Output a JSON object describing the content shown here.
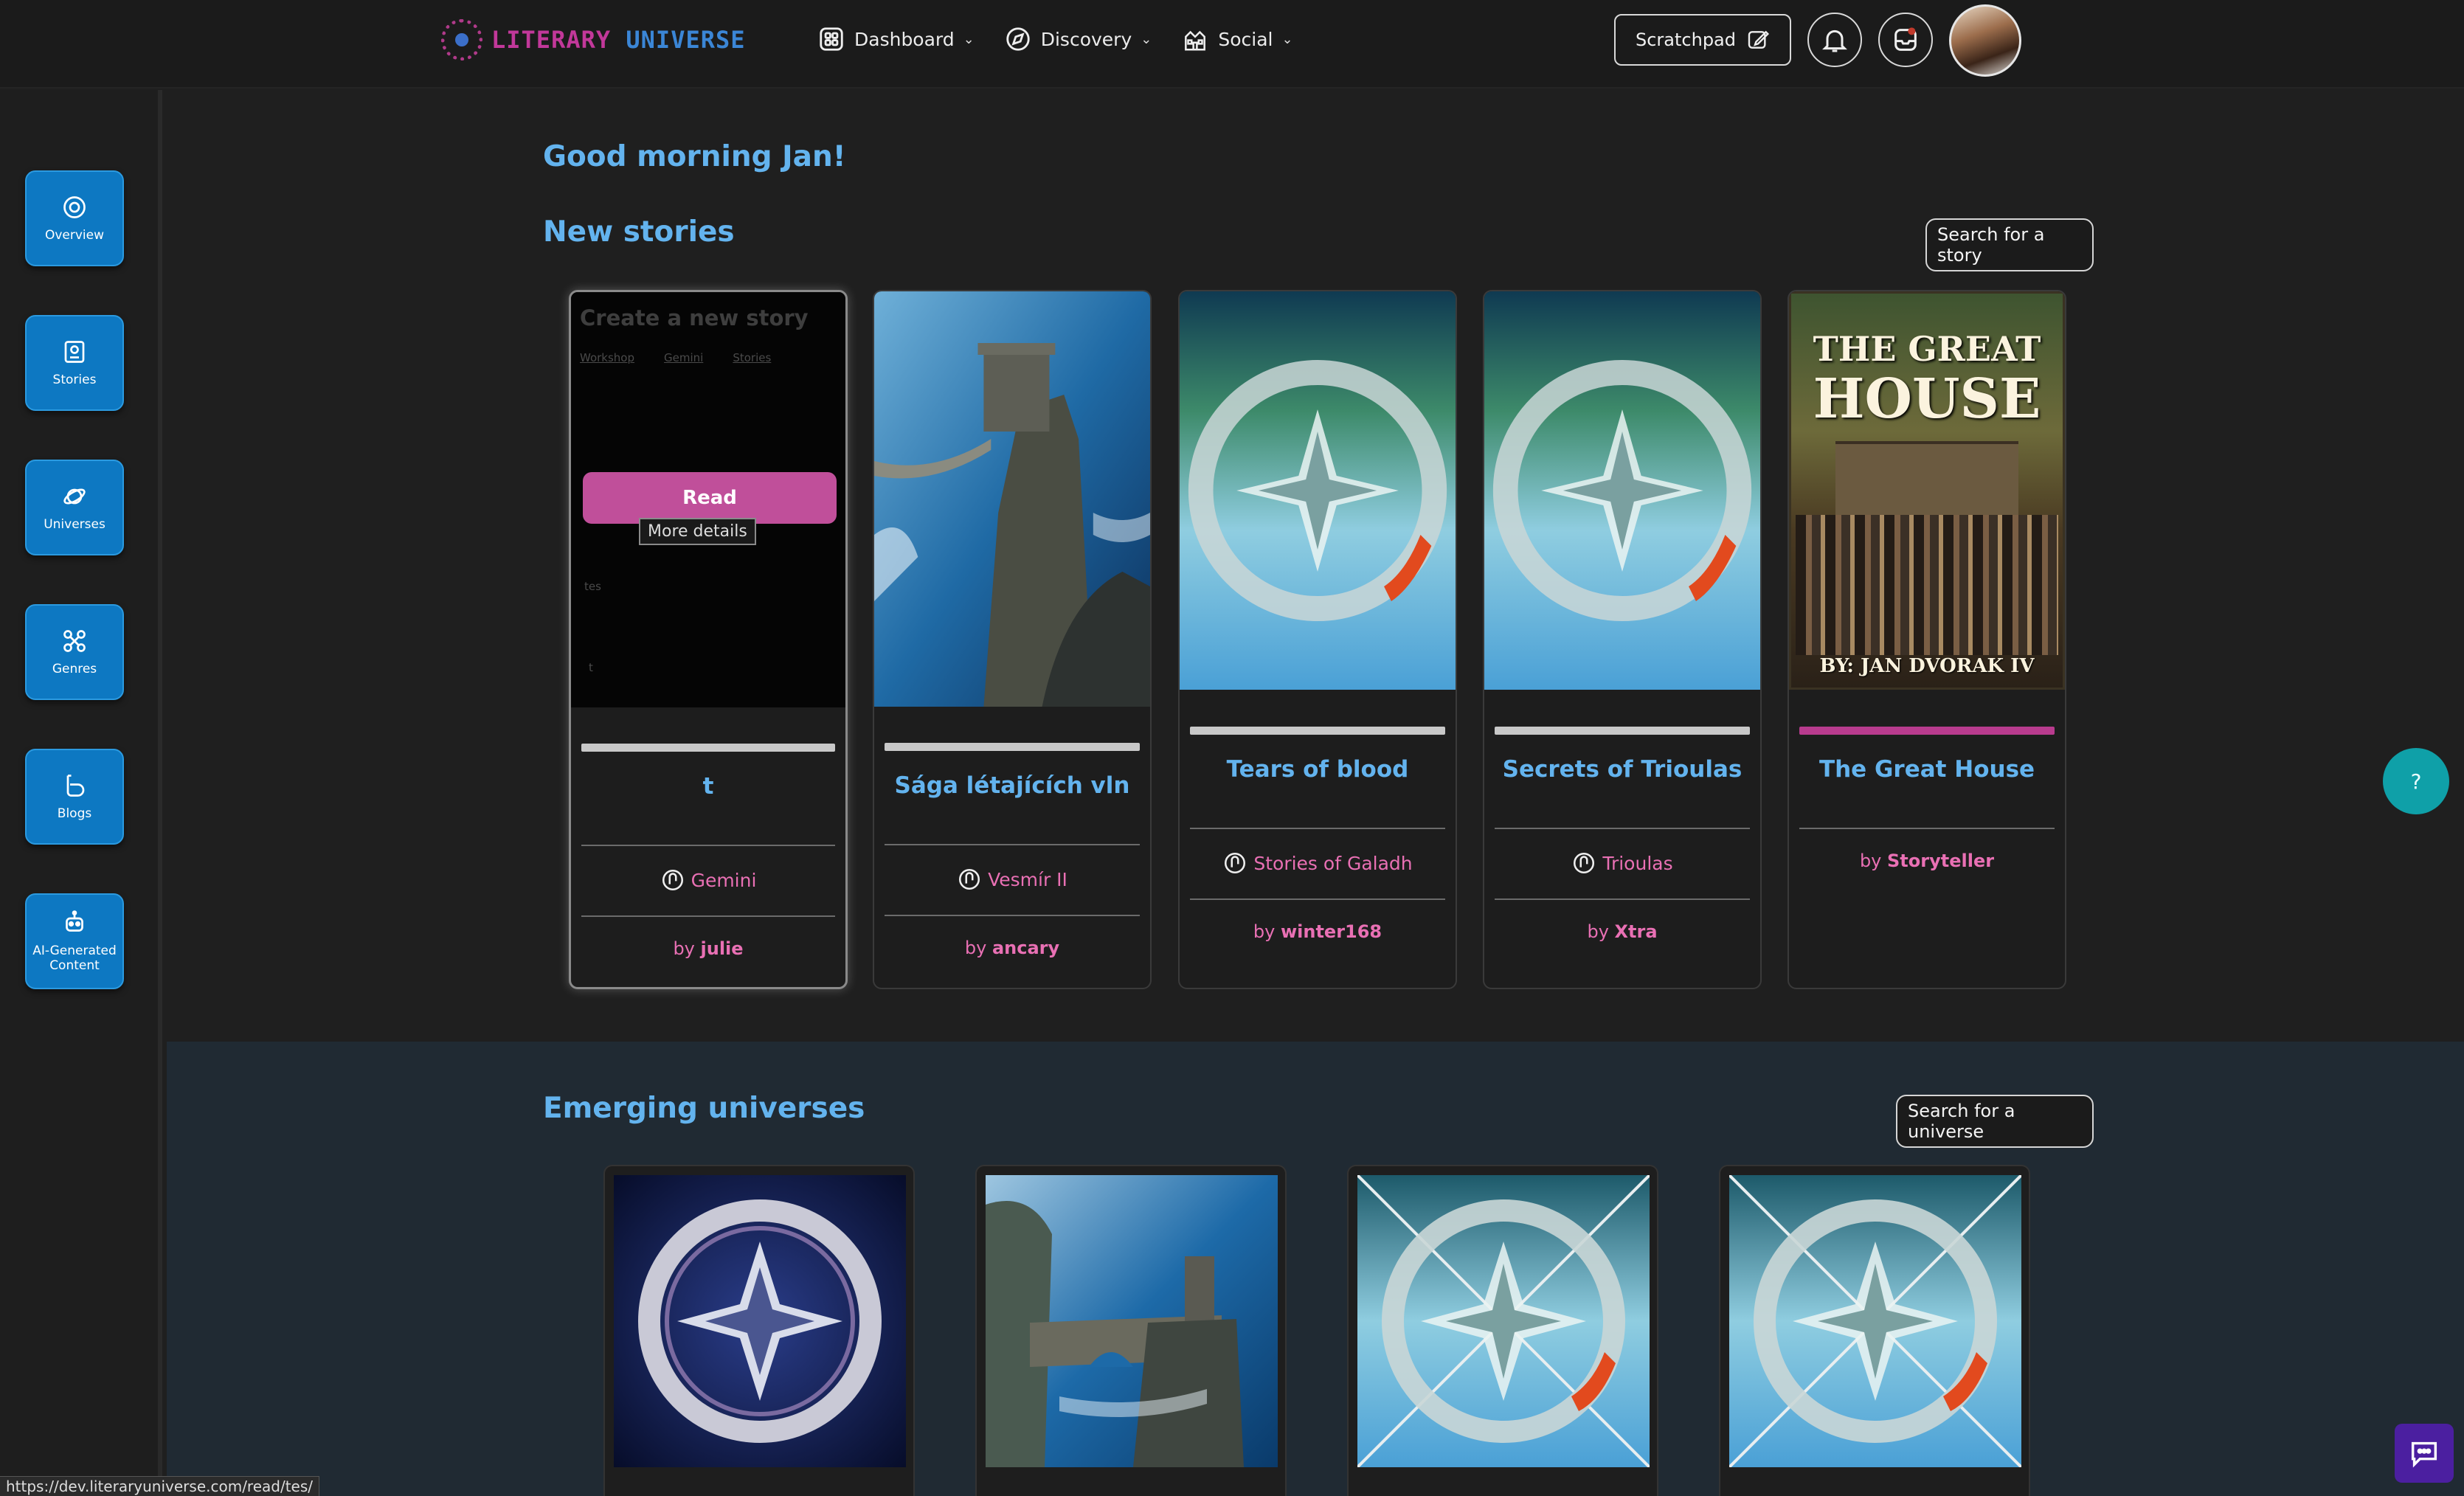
{
  "header": {
    "logo_literary": "LITERARY",
    "logo_universe": "UNIVERSE",
    "nav": [
      {
        "label": "Dashboard",
        "icon": "dashboard-icon"
      },
      {
        "label": "Discovery",
        "icon": "discovery-icon"
      },
      {
        "label": "Social",
        "icon": "social-icon"
      }
    ],
    "scratchpad_label": "Scratchpad"
  },
  "sidebar": {
    "items": [
      {
        "label": "Overview",
        "icon": "overview-icon"
      },
      {
        "label": "Stories",
        "icon": "stories-icon"
      },
      {
        "label": "Universes",
        "icon": "universes-icon"
      },
      {
        "label": "Genres",
        "icon": "genres-icon"
      },
      {
        "label": "Blogs",
        "icon": "blogs-icon"
      },
      {
        "label": "AI-Generated Content",
        "icon": "robot-icon"
      }
    ]
  },
  "main": {
    "greeting": "Good morning Jan!",
    "new_stories": {
      "title": "New stories",
      "search_label": "Search for a story",
      "cards": [
        {
          "title": "t",
          "universe": "Gemini",
          "by": "by",
          "author": "julie",
          "read_label": "Read",
          "more_label": "More details",
          "ghost_title": "Create a new story",
          "ghost_crumbs": [
            "Workshop",
            "Gemini",
            "Stories"
          ],
          "ghost_field1_value": "tes",
          "ghost_field2_value": "t"
        },
        {
          "title": "Sága létajících vln",
          "universe": "Vesmír II",
          "by": "by",
          "author": "ancary"
        },
        {
          "title": "Tears of blood",
          "universe": "Stories of Galadh",
          "by": "by",
          "author": "winter168"
        },
        {
          "title": "Secrets of Trioulas",
          "universe": "Trioulas",
          "by": "by",
          "author": "Xtra"
        },
        {
          "title": "The Great House",
          "universe": "",
          "by": "by",
          "author": "Storyteller",
          "cover_line1": "THE GREAT",
          "cover_line2": "HOUSE",
          "cover_byline": "BY: JAN DVORAK IV"
        }
      ]
    },
    "emerging_universes": {
      "title": "Emerging universes",
      "search_label": "Search for a universe"
    }
  },
  "help_label": "?",
  "status_url": "https://dev.literaryuniverse.com/read/tes/",
  "colors": {
    "accent_blue": "#63b3ee",
    "accent_pink": "#e970b4",
    "sidebar_button": "#0d78c2",
    "read_button": "#c04f9a",
    "help_button": "#0fa0a8",
    "chat_button": "#4b1fa0"
  }
}
